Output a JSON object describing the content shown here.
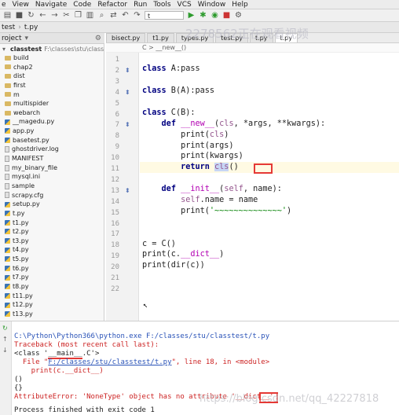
{
  "menu": [
    "e",
    "View",
    "Navigate",
    "Code",
    "Refactor",
    "Run",
    "Tools",
    "VCS",
    "Window",
    "Help"
  ],
  "toolbar": {
    "run_config": "t"
  },
  "navbar": {
    "crumbs": [
      "test",
      "t.py"
    ]
  },
  "project": {
    "header_label": "roject",
    "root_name": "classtest",
    "root_path": "F:\\classes\\stu\\classtest",
    "items": [
      {
        "name": "build",
        "kind": "folder"
      },
      {
        "name": "chap2",
        "kind": "folder"
      },
      {
        "name": "dist",
        "kind": "folder"
      },
      {
        "name": "first",
        "kind": "folder"
      },
      {
        "name": "m",
        "kind": "folder"
      },
      {
        "name": "multispider",
        "kind": "folder"
      },
      {
        "name": "webarch",
        "kind": "folder"
      },
      {
        "name": "__magedu.py",
        "kind": "py"
      },
      {
        "name": "app.py",
        "kind": "py"
      },
      {
        "name": "basetest.py",
        "kind": "py"
      },
      {
        "name": "ghostdriver.log",
        "kind": "file"
      },
      {
        "name": "MANIFEST",
        "kind": "file"
      },
      {
        "name": "my_binary_file",
        "kind": "file"
      },
      {
        "name": "mysql.ini",
        "kind": "file"
      },
      {
        "name": "sample",
        "kind": "file"
      },
      {
        "name": "scrapy.cfg",
        "kind": "file"
      },
      {
        "name": "setup.py",
        "kind": "py"
      },
      {
        "name": "t.py",
        "kind": "py"
      },
      {
        "name": "t1.py",
        "kind": "py"
      },
      {
        "name": "t2.py",
        "kind": "py"
      },
      {
        "name": "t3.py",
        "kind": "py"
      },
      {
        "name": "t4.py",
        "kind": "py"
      },
      {
        "name": "t5.py",
        "kind": "py"
      },
      {
        "name": "t6.py",
        "kind": "py"
      },
      {
        "name": "t7.py",
        "kind": "py"
      },
      {
        "name": "t8.py",
        "kind": "py"
      },
      {
        "name": "t11.py",
        "kind": "py"
      },
      {
        "name": "t12.py",
        "kind": "py"
      },
      {
        "name": "t13.py",
        "kind": "py"
      }
    ]
  },
  "tabs": [
    {
      "label": "bisect.py",
      "active": false
    },
    {
      "label": "t1.py",
      "active": false
    },
    {
      "label": "types.py",
      "active": false
    },
    {
      "label": "test.py",
      "active": false
    },
    {
      "label": "t.py",
      "active": false
    },
    {
      "label": "t.py",
      "active": true
    }
  ],
  "editor": {
    "breadcrumb": "C  >  __new__()",
    "line_numbers": [
      "1",
      "2",
      "3",
      "4",
      "5",
      "6",
      "7",
      "8",
      "9",
      "10",
      "11",
      "12",
      "13",
      "14",
      "15",
      "16",
      "17",
      "18",
      "19",
      "20",
      "21",
      "22"
    ]
  },
  "code": {
    "l2_kw": "class",
    "l2_rest": " A:pass",
    "l4_kw": "class",
    "l4_rest": " B(A):pass",
    "l6_kw": "class",
    "l6_rest": " C(B):",
    "l7_indent": "    ",
    "l7_kw": "def",
    "l7_sp": " ",
    "l7_name": "__new__",
    "l7_open": "(",
    "l7_self": "cls",
    "l7_rest": ", *args, **kwargs):",
    "l8_pre": "        print(",
    "l8_self": "cls",
    "l8_post": ")",
    "l9": "        print(args)",
    "l10": "        print(kwargs)",
    "l11_indent": "        ",
    "l11_kw": "return",
    "l11_sp": " ",
    "l11_self": "cls",
    "l11_post": "()",
    "l13_indent": "    ",
    "l13_kw": "def",
    "l13_sp": " ",
    "l13_name": "__init__",
    "l13_open": "(",
    "l13_self": "self",
    "l13_rest": ", name):",
    "l14_indent": "        ",
    "l14_self": "self",
    "l14_rest": ".name = name",
    "l15_pre": "        print(",
    "l15_str": "'~~~~~~~~~~~~~~'",
    "l15_post": ")",
    "l18": "c = C()",
    "l19_pre": "print(c.",
    "l19_magic": "__dict__",
    "l19_post": ")",
    "l20_pre": "print(dir(c))"
  },
  "console": {
    "cmd": "C:\\Python\\Python366\\python.exe F:/classes/stu/classtest/t.py",
    "tb": "Traceback (most recent call last):",
    "cls_pre": "<class '",
    "cls_main": "__main__",
    "cls_post": ".C'>",
    "file_pre": "  File \"",
    "file_link": "F:/classes/stu/classtest/t.py",
    "file_post": "\", line 18, in <module>",
    "code_line": "    print(c.__dict__)",
    "empty_tuple": "()",
    "empty_dict": "{}",
    "error": "AttributeError: 'NoneType' object has no attribute '__dict__'",
    "finished": "Process finished with exit code 1"
  },
  "overlay": {
    "viewers": "2278562正在观看视频",
    "source": "https://blog.csdn.net/qq_42227818"
  }
}
